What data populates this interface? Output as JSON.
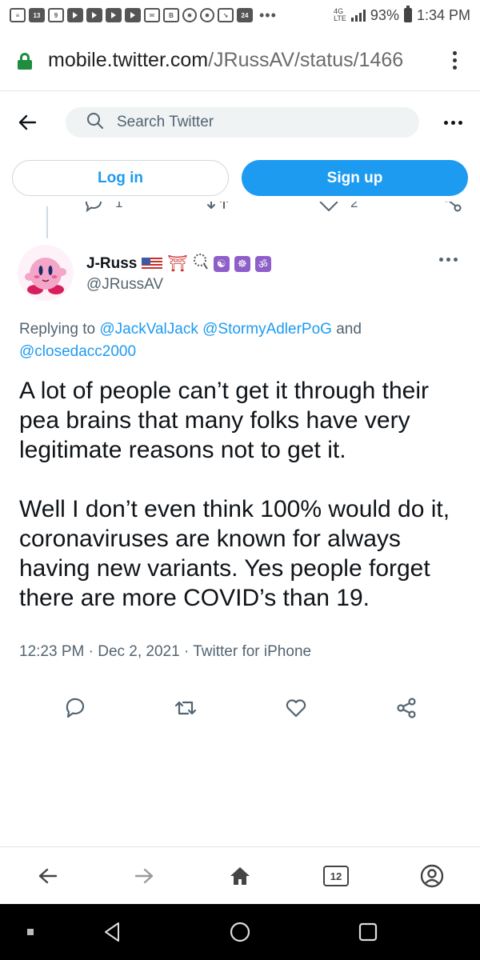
{
  "status_bar": {
    "news_label": "13",
    "battery": "93%",
    "time": "1:34 PM",
    "network": "4G",
    "lte": "LTE"
  },
  "browser": {
    "url_domain": "mobile.twitter.com",
    "url_path": "/JRussAV/status/1466",
    "tab_count": "12"
  },
  "twitter_header": {
    "search_placeholder": "Search Twitter",
    "login_label": "Log in",
    "signup_label": "Sign up"
  },
  "previous_tweet": {
    "reply_count": "1",
    "like_count": "2"
  },
  "tweet": {
    "author_name": "J-Russ",
    "handle": "@JRussAV",
    "replying_prefix": "Replying to",
    "mention_1": "@JackValJack",
    "mention_2": "@StormyAdlerPoG",
    "replying_and": "and",
    "mention_3": "@closedacc2000",
    "paragraph_1": "A lot of people can’t get it through their pea brains that many folks have very legitimate reasons not to get it.",
    "paragraph_2": "Well I don’t even think 100% would do it, coronaviruses are known for always having new variants. Yes people forget there are more COVID’s than 19.",
    "time": "12:23 PM",
    "date": "Dec 2, 2021",
    "source": "Twitter for iPhone",
    "separator": "·"
  },
  "colors": {
    "twitter_blue": "#1d9bf0",
    "secondary_text": "#536471",
    "lock_green": "#1e8e3e"
  }
}
